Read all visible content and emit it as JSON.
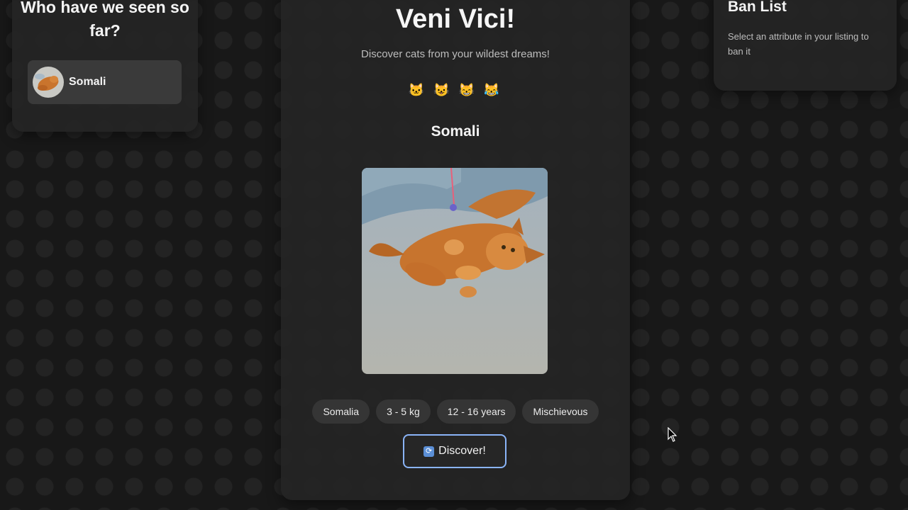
{
  "history": {
    "title": "Who have we seen so far?",
    "items": [
      {
        "label": "Somali"
      }
    ]
  },
  "main": {
    "title": "Veni Vici!",
    "subtitle": "Discover cats from your wildest dreams!",
    "emojis": "🐱 😺 😸 😹",
    "breed": "Somali",
    "attributes": [
      "Somalia",
      "3 - 5 kg",
      "12 - 16 years",
      "Mischievous"
    ],
    "discover_label": "Discover!",
    "discover_icon": "refresh-icon"
  },
  "ban": {
    "title": "Ban List",
    "description": "Select an attribute in your listing to ban it"
  },
  "colors": {
    "background": "#181818",
    "card": "#242424",
    "chip": "#353535",
    "button_border": "#8ab4f8"
  }
}
